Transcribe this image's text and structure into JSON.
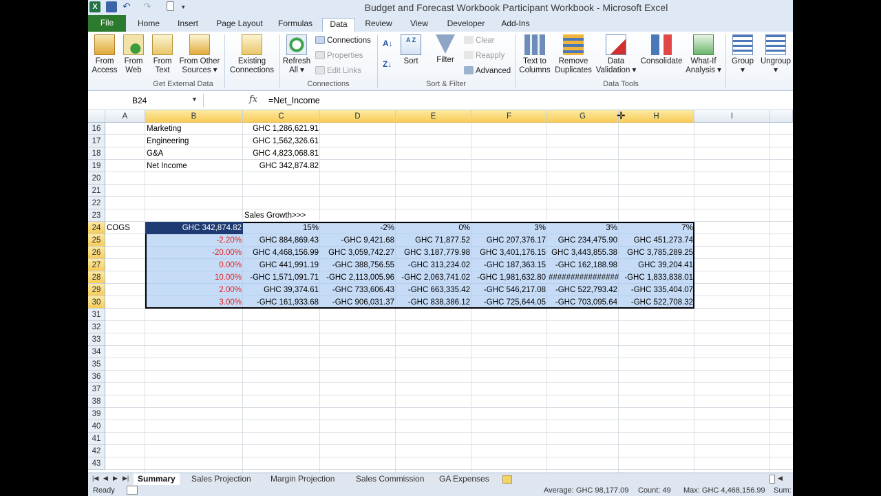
{
  "title": "Budget and Forecast Workbook Participant Workbook  -  Microsoft Excel",
  "tabs": [
    "File",
    "Home",
    "Insert",
    "Page Layout",
    "Formulas",
    "Data",
    "Review",
    "View",
    "Developer",
    "Add-Ins"
  ],
  "ribbon": {
    "get_external": {
      "from_access": [
        "From",
        "Access"
      ],
      "from_web": [
        "From",
        "Web"
      ],
      "from_text": [
        "From",
        "Text"
      ],
      "from_other": [
        "From Other",
        "Sources ▾"
      ],
      "existing": [
        "Existing",
        "Connections"
      ],
      "label": "Get External Data"
    },
    "connections": {
      "refresh": [
        "Refresh",
        "All ▾"
      ],
      "connections": "Connections",
      "properties": "Properties",
      "edit_links": "Edit Links",
      "label": "Connections"
    },
    "sort_filter": {
      "sort": "Sort",
      "filter": "Filter",
      "clear": "Clear",
      "reapply": "Reapply",
      "advanced": "Advanced",
      "label": "Sort & Filter"
    },
    "data_tools": {
      "text_to_columns": [
        "Text to",
        "Columns"
      ],
      "remove_duplicates": [
        "Remove",
        "Duplicates"
      ],
      "data_validation": [
        "Data",
        "Validation ▾"
      ],
      "consolidate": "Consolidate",
      "what_if": [
        "What-If",
        "Analysis ▾"
      ],
      "label": "Data Tools"
    },
    "outline": {
      "group": "Group",
      "ungroup": "Ungroup"
    }
  },
  "formula_bar": {
    "name_box": "B24",
    "fx": "fx",
    "formula": "=Net_Income"
  },
  "columns": [
    "A",
    "B",
    "C",
    "D",
    "E",
    "F",
    "G",
    "H",
    "I"
  ],
  "rows": [
    "16",
    "17",
    "18",
    "19",
    "20",
    "21",
    "22",
    "23",
    "24",
    "25",
    "26",
    "27",
    "28",
    "29",
    "30",
    "31",
    "32",
    "33",
    "34",
    "35",
    "36",
    "37",
    "38",
    "39",
    "40",
    "41",
    "42",
    "43"
  ],
  "cells": {
    "r16": {
      "b": "Marketing",
      "c": "GHC 1,286,621.91"
    },
    "r17": {
      "b": "Engineering",
      "c": "GHC 1,562,326.61"
    },
    "r18": {
      "b": "G&A",
      "c": "GHC 4,823,068.81"
    },
    "r19": {
      "b": "Net Income",
      "c": "GHC 342,874.82"
    },
    "r23": {
      "c": "Sales Growth>>>"
    },
    "r24": {
      "a": "COGS",
      "b": "GHC 342,874.82",
      "c": "15%",
      "d": "-2%",
      "e": "0%",
      "f": "3%",
      "g": "3%",
      "h": "7%"
    },
    "r25": {
      "b": "-2.20%",
      "c": "GHC 884,869.43",
      "d": "-GHC 9,421.68",
      "e": "GHC 71,877.52",
      "f": "GHC 207,376.17",
      "g": "GHC 234,475.90",
      "h": "GHC 451,273.74"
    },
    "r26": {
      "b": "-20.00%",
      "c": "GHC 4,468,156.99",
      "d": "GHC 3,059,742.27",
      "e": "GHC 3,187,779.98",
      "f": "GHC 3,401,176.15",
      "g": "GHC 3,443,855.38",
      "h": "GHC 3,785,289.25"
    },
    "r27": {
      "b": "0.00%",
      "c": "GHC 441,991.19",
      "d": "-GHC 388,756.55",
      "e": "-GHC 313,234.02",
      "f": "-GHC 187,363.15",
      "g": "-GHC 162,188.98",
      "h": "GHC 39,204.41"
    },
    "r28": {
      "b": "10.00%",
      "c": "-GHC 1,571,091.71",
      "d": "-GHC 2,113,005.96",
      "e": "-GHC 2,063,741.02",
      "f": "-GHC 1,981,632.80",
      "g": "################",
      "h": "-GHC 1,833,838.01"
    },
    "r29": {
      "b": "2.00%",
      "c": "GHC 39,374.61",
      "d": "-GHC 733,606.43",
      "e": "-GHC 663,335.42",
      "f": "-GHC 546,217.08",
      "g": "-GHC 522,793.42",
      "h": "-GHC 335,404.07"
    },
    "r30": {
      "b": "3.00%",
      "c": "-GHC 161,933.68",
      "d": "-GHC 906,031.37",
      "e": "-GHC 838,386.12",
      "f": "-GHC 725,644.05",
      "g": "-GHC 703,095.64",
      "h": "-GHC 522,708.32"
    }
  },
  "sheets": [
    "Summary",
    "Sales Projection",
    "Margin Projection",
    "Sales Commission",
    "GA Expenses"
  ],
  "status": {
    "ready": "Ready",
    "average": "Average: GHC 98,177.09",
    "count": "Count: 49",
    "max": "Max: GHC 4,468,156.99",
    "sum": "Sum:"
  },
  "colors": {
    "file_tab": "#2c7a2e",
    "selection": "#a0c4f0",
    "active_cell": "#1f3b73",
    "header_sel": "#f7cd59",
    "negative": "#e02020"
  }
}
